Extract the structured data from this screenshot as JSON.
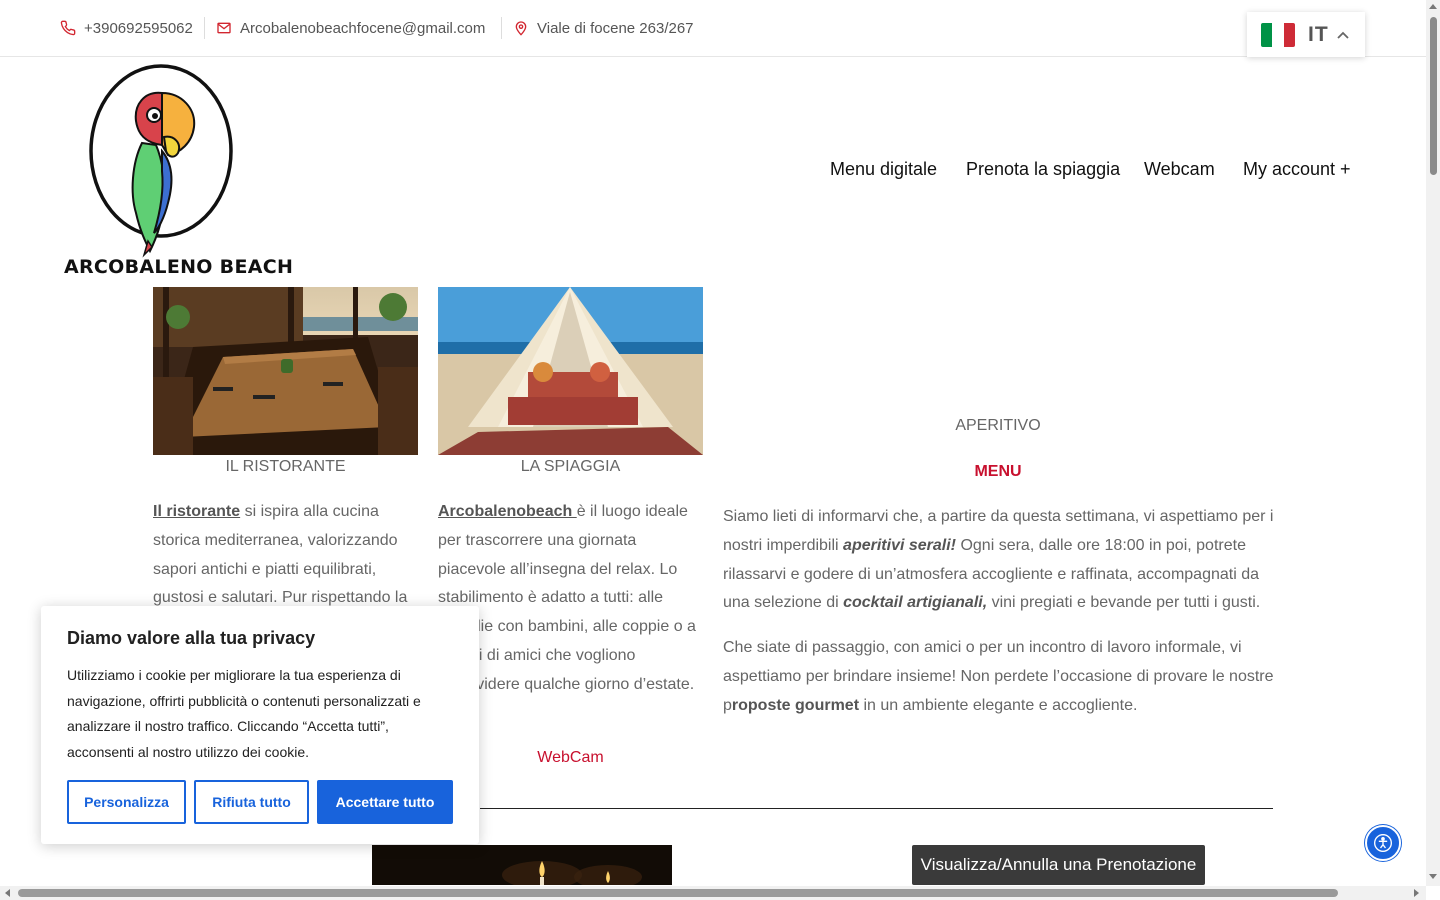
{
  "topbar": {
    "phone": "+390692595062",
    "email": "Arcobalenobeachfocene@gmail.com",
    "address": "Viale di focene 263/267"
  },
  "language": {
    "code": "IT",
    "flag_colors": [
      "#009246",
      "#ffffff",
      "#ce2b37"
    ]
  },
  "logo": {
    "text": "ARCOBALENO BEACH"
  },
  "nav": {
    "items": [
      {
        "label": "Menu digitale"
      },
      {
        "label": "Prenota la spiaggia"
      },
      {
        "label": "Webcam"
      },
      {
        "label": "My account +"
      }
    ]
  },
  "columns": {
    "restaurant": {
      "caption": "IL RISTORANTE",
      "link": "Il ristorante",
      "text": " si ispira alla cucina storica mediterranea, valorizzando sapori antichi e piatti equilibrati, gustosi e salutari. Pur rispettando la"
    },
    "beach": {
      "caption": "LA SPIAGGIA",
      "link": "Arcobalenobeach ",
      "text": "è il luogo ideale per trascorrere una giornata piacevole all’insegna del relax. Lo stabilimento è adatto a tutti: alle famiglie con bambini, alle coppie o a gruppi di amici che vogliono condividere qualche giorno d’estate.",
      "webcam_link": "WebCam"
    },
    "aperitivo": {
      "heading": "APERITIVO",
      "menu_link": "MENU",
      "p1_a": "Siamo lieti di informarvi che, a partire da questa settimana, vi aspettiamo per i nostri imperdibili ",
      "p1_em": "aperitivi serali!",
      "p1_b": " Ogni sera, dalle ore 18:00 in poi, potrete rilassarvi e godere di un’atmosfera accogliente e raffinata, accompagnati da una selezione di ",
      "p1_em2": "cocktail artigianali,",
      "p1_c": " vini pregiati e bevande per tutti i gusti.",
      "p2_a": "Che siate di passaggio, con amici o per un incontro di lavoro informale, vi aspettiamo per brindare insieme! Non perdete l’occasione di provare le nostre p",
      "p2_b": "roposte gourmet",
      "p2_c": " in un ambiente elegante e accogliente."
    }
  },
  "booking_button": "Visualizza/Annulla una Prenotazione",
  "cookie": {
    "title": "Diamo valore alla tua privacy",
    "text": "Utilizziamo i cookie per migliorare la tua esperienza di navigazione, offrirti pubblicità o contenuti personalizzati e analizzare il nostro traffico. Cliccando “Accetta tutti”, acconsenti al nostro utilizzo dei cookie.",
    "customize": "Personalizza",
    "reject": "Rifiuta tutto",
    "accept": "Accettare tutto",
    "accent": "#1863dc"
  },
  "colors": {
    "accent_red": "#c8102e",
    "button_dark": "#3a3a3a"
  }
}
